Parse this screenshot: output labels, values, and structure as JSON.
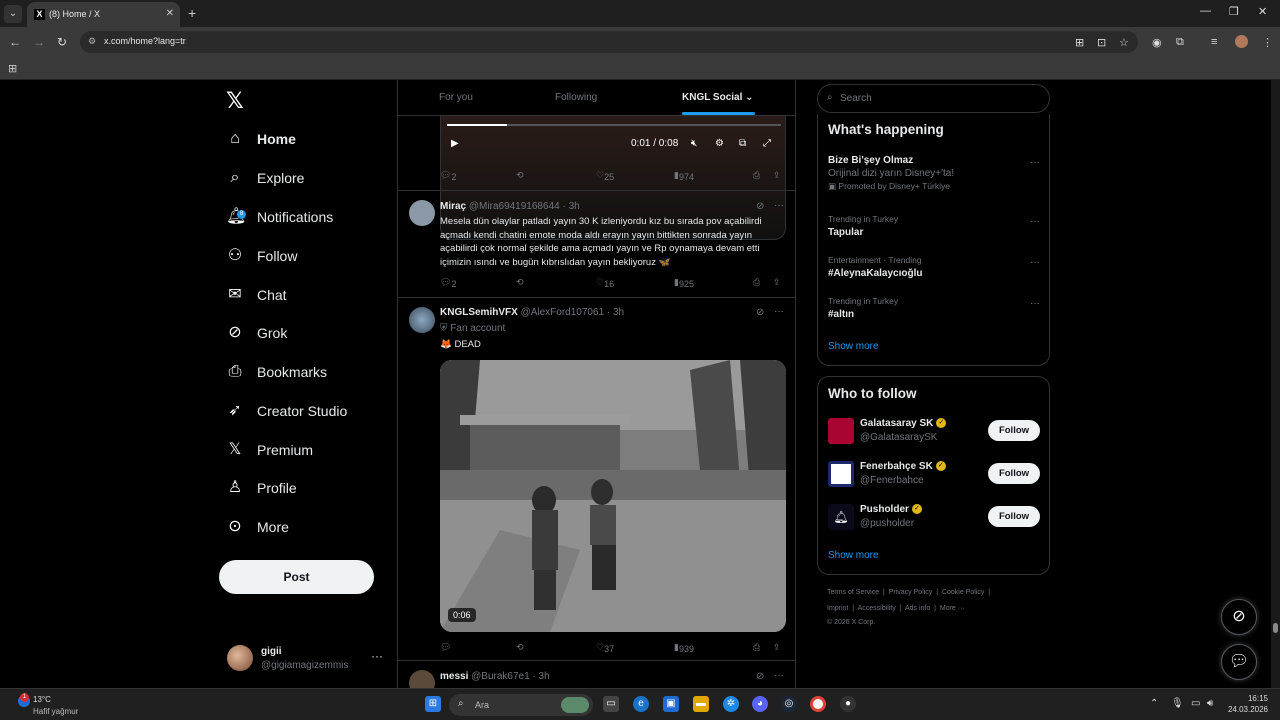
{
  "browser": {
    "tab_title": "(8) Home / X",
    "url": "x.com/home?lang=tr"
  },
  "nav": {
    "items": [
      {
        "label": "Home",
        "icon": "home-icon"
      },
      {
        "label": "Explore",
        "icon": "search-icon"
      },
      {
        "label": "Notifications",
        "icon": "bell-icon",
        "badge": "8"
      },
      {
        "label": "Follow",
        "icon": "add-user-icon"
      },
      {
        "label": "Chat",
        "icon": "mail-icon"
      },
      {
        "label": "Grok",
        "icon": "grok-icon"
      },
      {
        "label": "Bookmarks",
        "icon": "bookmark-icon"
      },
      {
        "label": "Creator Studio",
        "icon": "rocket-icon"
      },
      {
        "label": "Premium",
        "icon": "x-icon"
      },
      {
        "label": "Profile",
        "icon": "person-icon"
      },
      {
        "label": "More",
        "icon": "more-circle-icon"
      }
    ],
    "post_label": "Post",
    "account": {
      "name": "gigii",
      "handle": "@gigiamagizemmis"
    }
  },
  "timeline": {
    "tabs": [
      "For you",
      "Following",
      "KNGL Social"
    ],
    "video1": {
      "time": "0:01 / 0:08",
      "progress": 0.18
    },
    "video1_actions": {
      "replies": "2",
      "likes": "25",
      "views": "974"
    },
    "posts": [
      {
        "name": "Miraç",
        "meta": "@Mira69419168644 · 3h",
        "text": "Mesela dün olaylar patladı yayın 30 K izleniyordu kız bu sırada pov açabilirdi açmadı kendi chatini emote moda aldı erayın yayın bittikten sonrada yayın açabilirdi çok normal şekilde ama açmadı yayın ve Rp oynamaya devam etti içimizin ısındı ve bugün kıbrıslıdan yayın bekliyoruz 🦋",
        "replies": "2",
        "likes": "16",
        "views": "925"
      },
      {
        "name": "KNGLSemihVFX",
        "meta": "@AlexFord107061 · 3h",
        "label": "Fan account",
        "text": "🦊 DEAD",
        "video_duration": "0:06",
        "replies": "",
        "likes": "37",
        "views": "939"
      },
      {
        "name": "messi",
        "meta": "@Burak67e1 · 3h"
      }
    ]
  },
  "sidebar": {
    "search_placeholder": "Search",
    "happening_title": "What's happening",
    "trends": [
      {
        "context": "",
        "title": "Bize Bi'şey Olmaz",
        "sub": "Orijinal dizi yarın Disney+'ta!",
        "promo": "Promoted by Disney+ Türkiye"
      },
      {
        "context": "Trending in Turkey",
        "title": "Tapular"
      },
      {
        "context": "Entertainment · Trending",
        "title": "#AleynaKalaycıoğlu"
      },
      {
        "context": "Trending in Turkey",
        "title": "#altın"
      }
    ],
    "show_more": "Show more",
    "who_title": "Who to follow",
    "follow_label": "Follow",
    "who": [
      {
        "name": "Galatasaray SK",
        "handle": "@GalatasaraySK"
      },
      {
        "name": "Fenerbahçe SK",
        "handle": "@Fenerbahce"
      },
      {
        "name": "Pusholder",
        "handle": "@pusholder"
      }
    ],
    "footer_line1": [
      "Terms of Service",
      "Privacy Policy",
      "Cookie Policy"
    ],
    "footer_line2": [
      "Imprint",
      "Accessibility",
      "Ads info",
      "More ···"
    ],
    "copyright": "© 2026 X Corp."
  },
  "taskbar": {
    "temp": "13°C",
    "weather": "Hafif yağmur",
    "notification_count": "1",
    "search_placeholder": "Ara",
    "time": "16:15",
    "date": "24.03.2026"
  }
}
